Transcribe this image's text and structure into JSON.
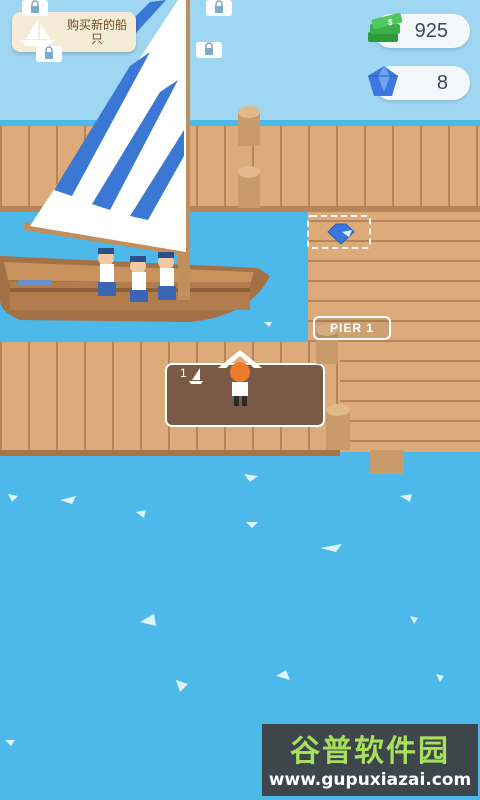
{
  "hud": {
    "cash": "925",
    "gems": "8",
    "cash_icon": "cash-stack-icon",
    "gem_icon": "blue-gem-icon"
  },
  "shop": {
    "label": "购买新的船只",
    "icon": "sailboat-icon"
  },
  "world": {
    "pier_label": "PIER 1",
    "berth_number": "1",
    "locked_icon": "lock-icon"
  },
  "watermark": {
    "title": "谷普软件园",
    "url": "www.gupuxiazai.com"
  },
  "colors": {
    "water": "#4db8ea",
    "wood": "#d9a876",
    "wood_dark": "#b9885a",
    "sail_blue": "#3a78d4",
    "gem": "#3a78e0",
    "cash": "#3bb04a"
  }
}
